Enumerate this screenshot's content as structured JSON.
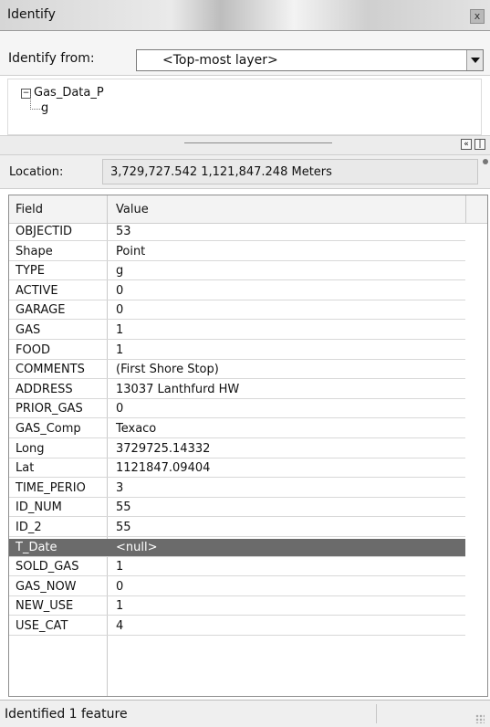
{
  "window": {
    "title": "Identify",
    "close_label": "x"
  },
  "identify_from": {
    "label": "Identify from:",
    "value": "<Top-most layer>"
  },
  "tree": {
    "layer": "Gas_Data_P",
    "feature": "g",
    "expand_symbol": "−"
  },
  "location": {
    "label": "Location:",
    "value": "3,729,727.542  1,121,847.248 Meters"
  },
  "table": {
    "headers": {
      "field": "Field",
      "value": "Value"
    },
    "rows": [
      {
        "field": "OBJECTID",
        "value": "53"
      },
      {
        "field": "Shape",
        "value": "Point"
      },
      {
        "field": "TYPE",
        "value": "g"
      },
      {
        "field": "ACTIVE",
        "value": "0"
      },
      {
        "field": "GARAGE",
        "value": "0"
      },
      {
        "field": "GAS",
        "value": "1"
      },
      {
        "field": "FOOD",
        "value": "1"
      },
      {
        "field": "COMMENTS",
        "value": "(First Shore Stop)"
      },
      {
        "field": "ADDRESS",
        "value": "13037 Lanthfurd HW"
      },
      {
        "field": "PRIOR_GAS",
        "value": "0"
      },
      {
        "field": "GAS_Comp",
        "value": "Texaco"
      },
      {
        "field": "Long",
        "value": "3729725.14332"
      },
      {
        "field": "Lat",
        "value": "1121847.09404"
      },
      {
        "field": "TIME_PERIO",
        "value": "3"
      },
      {
        "field": "ID_NUM",
        "value": "55"
      },
      {
        "field": "ID_2",
        "value": "55"
      },
      {
        "field": "T_Date",
        "value": "<null>",
        "selected": true
      },
      {
        "field": "SOLD_GAS",
        "value": "1"
      },
      {
        "field": "GAS_NOW",
        "value": "0"
      },
      {
        "field": "NEW_USE",
        "value": "1"
      },
      {
        "field": "USE_CAT",
        "value": "4"
      }
    ]
  },
  "status": {
    "text": "Identified 1 feature"
  },
  "icons": {
    "close": "close-icon",
    "dropdown": "chevron-down-icon",
    "expand_all": "expand-all-icon",
    "collapse": "collapse-icon",
    "pin": "pin-icon",
    "grip": "resize-grip-icon"
  }
}
